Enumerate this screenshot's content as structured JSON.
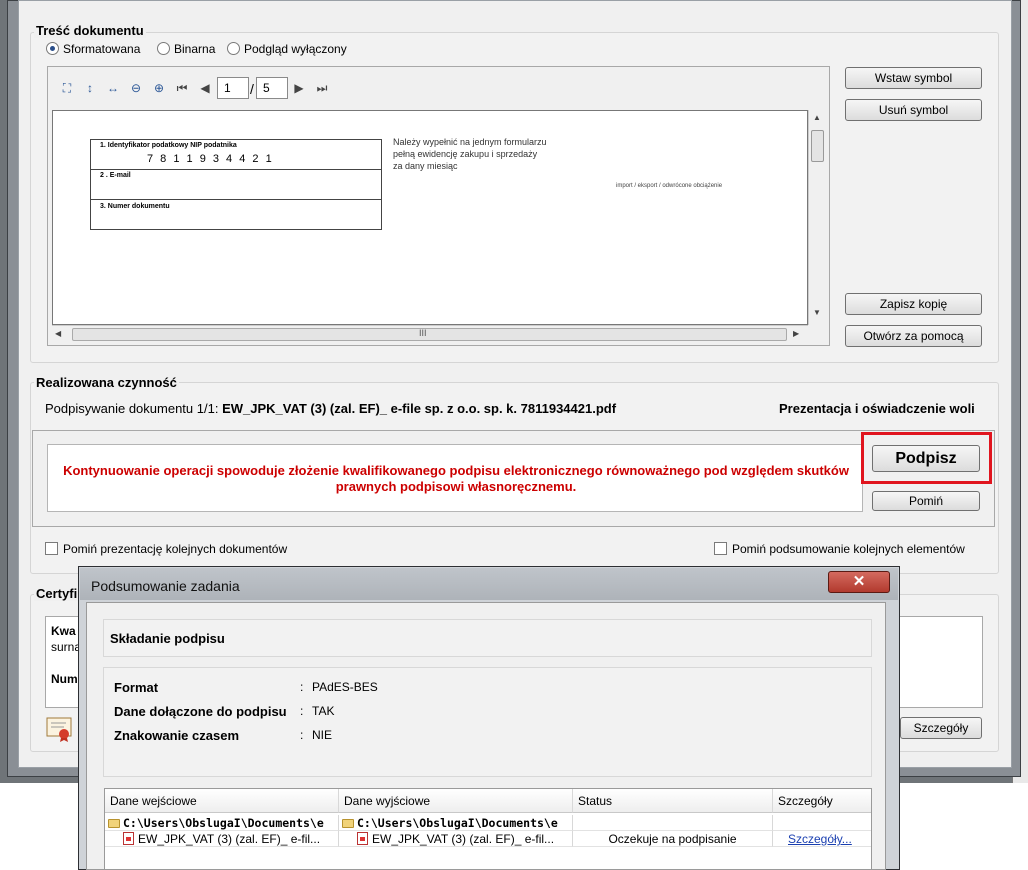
{
  "content_group": {
    "title": "Treść dokumentu",
    "radios": [
      {
        "label": "Sformatowana",
        "selected": true
      },
      {
        "label": "Binarna",
        "selected": false
      },
      {
        "label": "Podgląd wyłączony",
        "selected": false
      }
    ]
  },
  "viewer": {
    "page_current": "1",
    "page_separator": "/",
    "page_total": "5",
    "toolbar_icons": [
      "fit-page-icon",
      "fit-height-icon",
      "fit-width-icon",
      "zoom-out-icon",
      "zoom-in-icon",
      "first-page-icon",
      "prev-page-icon",
      "next-page-icon",
      "last-page-icon"
    ],
    "document": {
      "field1_label": "1. Identyfikator podatkowy NIP podatnika",
      "field1_value": "7 8 1 1 9 3 4 4 2 1",
      "field2_label": "2 . E-mail",
      "field3_label": "3. Numer dokumentu",
      "note_lines": [
        "Należy wypełnić na jednym formularzu",
        "pełną ewidencję zakupu i sprzedaży",
        "za dany miesiąc"
      ],
      "note_small": "import / eksport / odwrócone obciążenie"
    },
    "hscroll_grip": "III"
  },
  "side_buttons": {
    "insert_symbol": "Wstaw symbol",
    "remove_symbol": "Usuń symbol",
    "save_copy": "Zapisz kopię",
    "open_with": "Otwórz za pomocą"
  },
  "activity": {
    "title": "Realizowana czynność",
    "prefix": "Podpisywanie dokumentu 1/1: ",
    "filename": "EW_JPK_VAT (3) (zal. EF)_ e-file sp. z o.o. sp. k. 7811934421.pdf",
    "right_label": "Prezentacja i oświadczenie woli",
    "warning": "Kontynuowanie operacji spowoduje złożenie kwalifikowanego podpisu elektronicznego równoważnego pod względem skutków prawnych podpisowi własnoręcznemu.",
    "sign_button": "Podpisz",
    "skip_button": "Pomiń",
    "highlight_color": "#e0141e"
  },
  "options": {
    "skip_presentation": "Pomiń prezentację kolejnych dokumentów",
    "skip_summary": "Pomiń podsumowanie kolejnych elementów"
  },
  "certificate": {
    "title_partial": "Certyfi",
    "line1_partial": "Kwa",
    "line2_partial": "surna",
    "line3_partial": "Num",
    "details_button": "Szczegóły"
  },
  "dialog": {
    "title": "Podsumowanie zadania",
    "close_glyph": "✕",
    "section_title": "Składanie podpisu",
    "props": [
      {
        "key": "Format",
        "sep": ":",
        "value": "PAdES-BES"
      },
      {
        "key": "Dane dołączone do podpisu",
        "sep": ":",
        "value": "TAK"
      },
      {
        "key": "Znakowanie czasem",
        "sep": ":",
        "value": "NIE"
      }
    ],
    "table": {
      "columns": [
        "Dane wejściowe",
        "Dane wyjściowe",
        "Status",
        "Szczegóły"
      ],
      "folder_row": [
        "C:\\Users\\ObslugaI\\Documents\\e",
        "C:\\Users\\ObslugaI\\Documents\\e"
      ],
      "file_row": {
        "input": "EW_JPK_VAT (3) (zal. EF)_ e-fil...",
        "output": "EW_JPK_VAT (3) (zal. EF)_ e-fil...",
        "status": "Oczekuje na podpisanie",
        "details_link": "Szczegóły..."
      }
    }
  }
}
